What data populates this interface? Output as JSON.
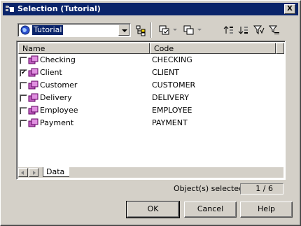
{
  "window": {
    "title": "Selection (Tutorial)",
    "close_label": "X"
  },
  "toolbar": {
    "model_combo": {
      "value": "Tutorial",
      "icon": "globe-icon"
    }
  },
  "list": {
    "columns": [
      "Name",
      "Code"
    ],
    "rows": [
      {
        "name": "Checking",
        "code": "CHECKING",
        "checked": false
      },
      {
        "name": "Client",
        "code": "CLIENT",
        "checked": true
      },
      {
        "name": "Customer",
        "code": "CUSTOMER",
        "checked": false
      },
      {
        "name": "Delivery",
        "code": "DELIVERY",
        "checked": false
      },
      {
        "name": "Employee",
        "code": "EMPLOYEE",
        "checked": false
      },
      {
        "name": "Payment",
        "code": "PAYMENT",
        "checked": false
      }
    ],
    "check_mark": "✔",
    "tabs": [
      "Data"
    ]
  },
  "selection": {
    "label": "Object(s) selected:",
    "count": "1 / 6"
  },
  "buttons": {
    "ok": "OK",
    "cancel": "Cancel",
    "help": "Help"
  }
}
